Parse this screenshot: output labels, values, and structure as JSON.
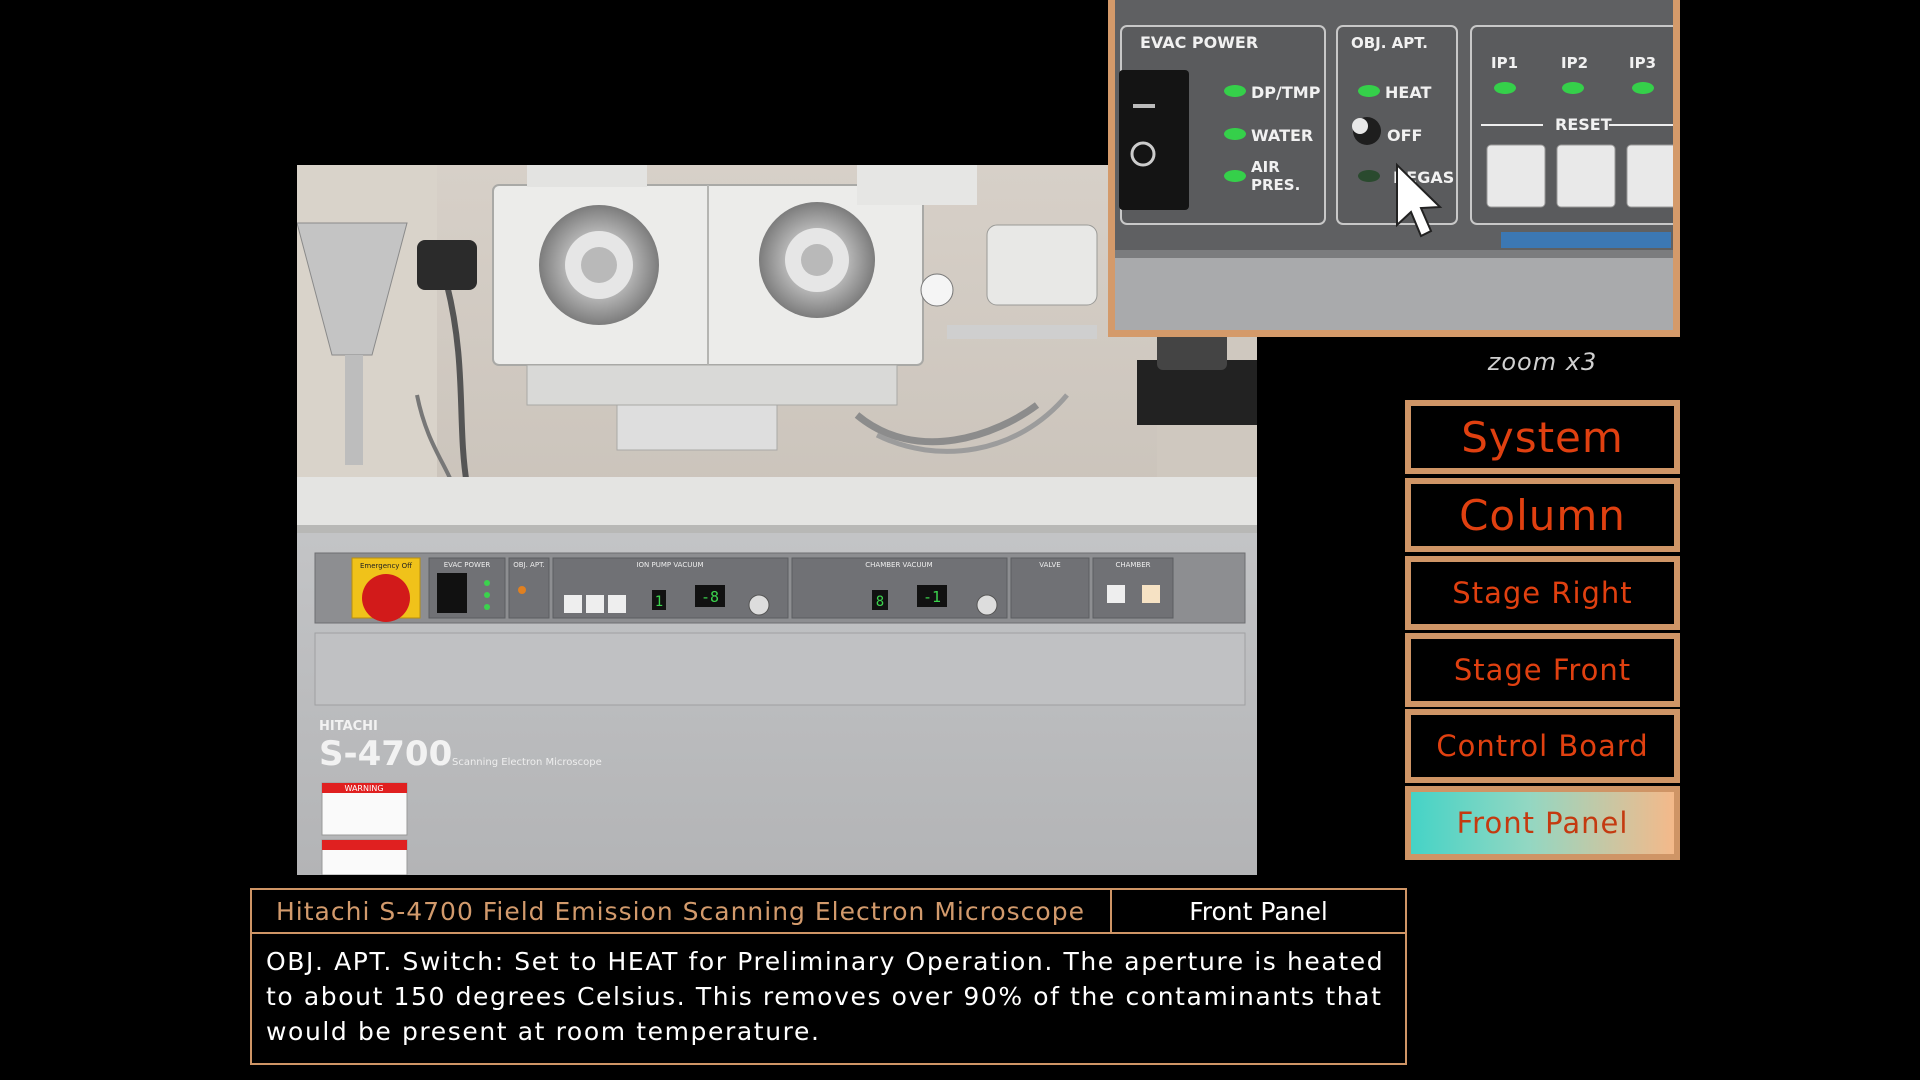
{
  "zoom": {
    "caption": "zoom x3",
    "labels": {
      "evac_power": "EVAC POWER",
      "dp_tmp": "DP/TMP",
      "water": "WATER",
      "air": "AIR",
      "pres": "PRES.",
      "obj_apt": "OBJ. APT.",
      "heat": "HEAT",
      "off": "OFF",
      "degas": "DEGAS",
      "ip1": "IP1",
      "ip2": "IP2",
      "ip3": "IP3",
      "reset": "RESET"
    }
  },
  "nav": {
    "items": [
      {
        "label": "System"
      },
      {
        "label": "Column"
      },
      {
        "label": "Stage Right"
      },
      {
        "label": "Stage Front"
      },
      {
        "label": "Control Board"
      },
      {
        "label": "Front Panel"
      }
    ],
    "active": "Front Panel"
  },
  "photo": {
    "brand": "HITACHI",
    "model": "S-4700",
    "subtitle": "Scanning Electron Microscope",
    "emergency": "Emergency Off",
    "panel_labels": {
      "evac_power": "EVAC POWER",
      "obj_apt": "OBJ. APT.",
      "ion_pump": "ION PUMP VACUUM",
      "chamber_vacuum": "CHAMBER VACUUM",
      "valve": "VALVE",
      "chamber": "CHAMBER",
      "reset": "RESET",
      "x10": "×10",
      "pa": "Pa",
      "digit_ion_1": "1",
      "digit_ion_exp": "-8",
      "digit_ch_1": "8",
      "digit_ch_exp": "-1",
      "warning": "WARNING"
    }
  },
  "info": {
    "title": "Hitachi S-4700 Field Emission Scanning Electron Microscope",
    "section": "Front Panel",
    "body": "OBJ. APT. Switch: Set to HEAT for Preliminary Operation. The aperture is heated to about 150 degrees Celsius. This removes over 90% of the contaminants that would be present at room temperature."
  },
  "colors": {
    "accent_border": "#cf9566",
    "nav_text": "#e04010",
    "title_text": "#d29a6c",
    "led_green": "#34d24a"
  }
}
